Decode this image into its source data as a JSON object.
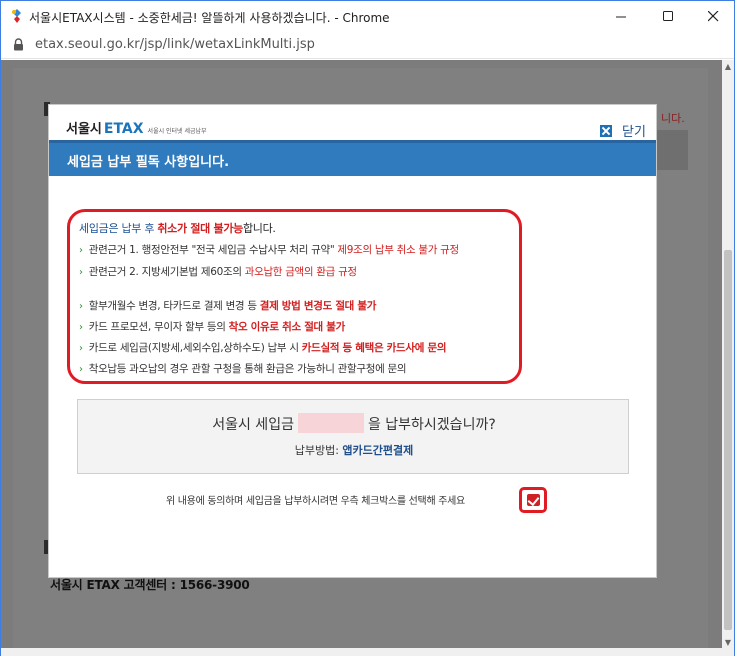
{
  "window": {
    "title": "서울시ETAX시스템 - 소중한세금! 알뜰하게 사용하겠습니다. - Chrome",
    "url": "etax.seoul.go.kr/jsp/link/wetaxLinkMulti.jsp"
  },
  "background_page": {
    "footer": "서울시 ETAX 고객센터 : 1566-3900",
    "red_note": "니다."
  },
  "modal": {
    "logo": {
      "main": "서울시",
      "accent": "ETAX",
      "sub": "서울시 인터넷 세금납부"
    },
    "close_label": "닫기",
    "header_title": "세입금 납부 필독 사항입니다.",
    "notice": {
      "lead": {
        "a": "세입금은 납부 후 ",
        "b": "취소가 절대 불가능",
        "c": "합니다."
      },
      "items": [
        {
          "a": "관련근거 1. 행정안전부 \"전국 세입금 수납사무 처리 규약\" ",
          "b": "제9조의 납부 취소 불가 규정"
        },
        {
          "a": "관련근거 2. 지방세기본법 제60조의 ",
          "b": "과오납한 금액의 환급 규정"
        },
        {
          "a": "할부개월수 변경, 타카드로 결제 변경 등 ",
          "b": "결제 방법 변경도 절대 불가"
        },
        {
          "a": "카드 프로모션, 무이자 할부 등의 ",
          "b": "착오 이유로 취소 절대 불가"
        },
        {
          "a": "카드로 세입금(지방세,세외수입,상하수도) 납부 시 ",
          "b": "카드실적 등 혜택은 카드사에 문의"
        },
        {
          "a": "착오납등 과오납의 경우 관할 구청을 통해 환급은 가능하니 관할구청에 문의",
          "b": ""
        }
      ]
    },
    "confirm": {
      "question_prefix": "서울시 세입금",
      "question_suffix": "을 납부하시겠습니까?",
      "method_label": "납부방법: ",
      "method_value": "앱카드간편결제"
    },
    "agree_text": "위 내용에 동의하며 세입금을 납부하시려면 우측 체크박스를 선택해 주세요",
    "agree_checked": true
  },
  "colors": {
    "accent": "#2f7bbe",
    "warning": "#e01b24",
    "overlay": "#7c7c7c"
  }
}
